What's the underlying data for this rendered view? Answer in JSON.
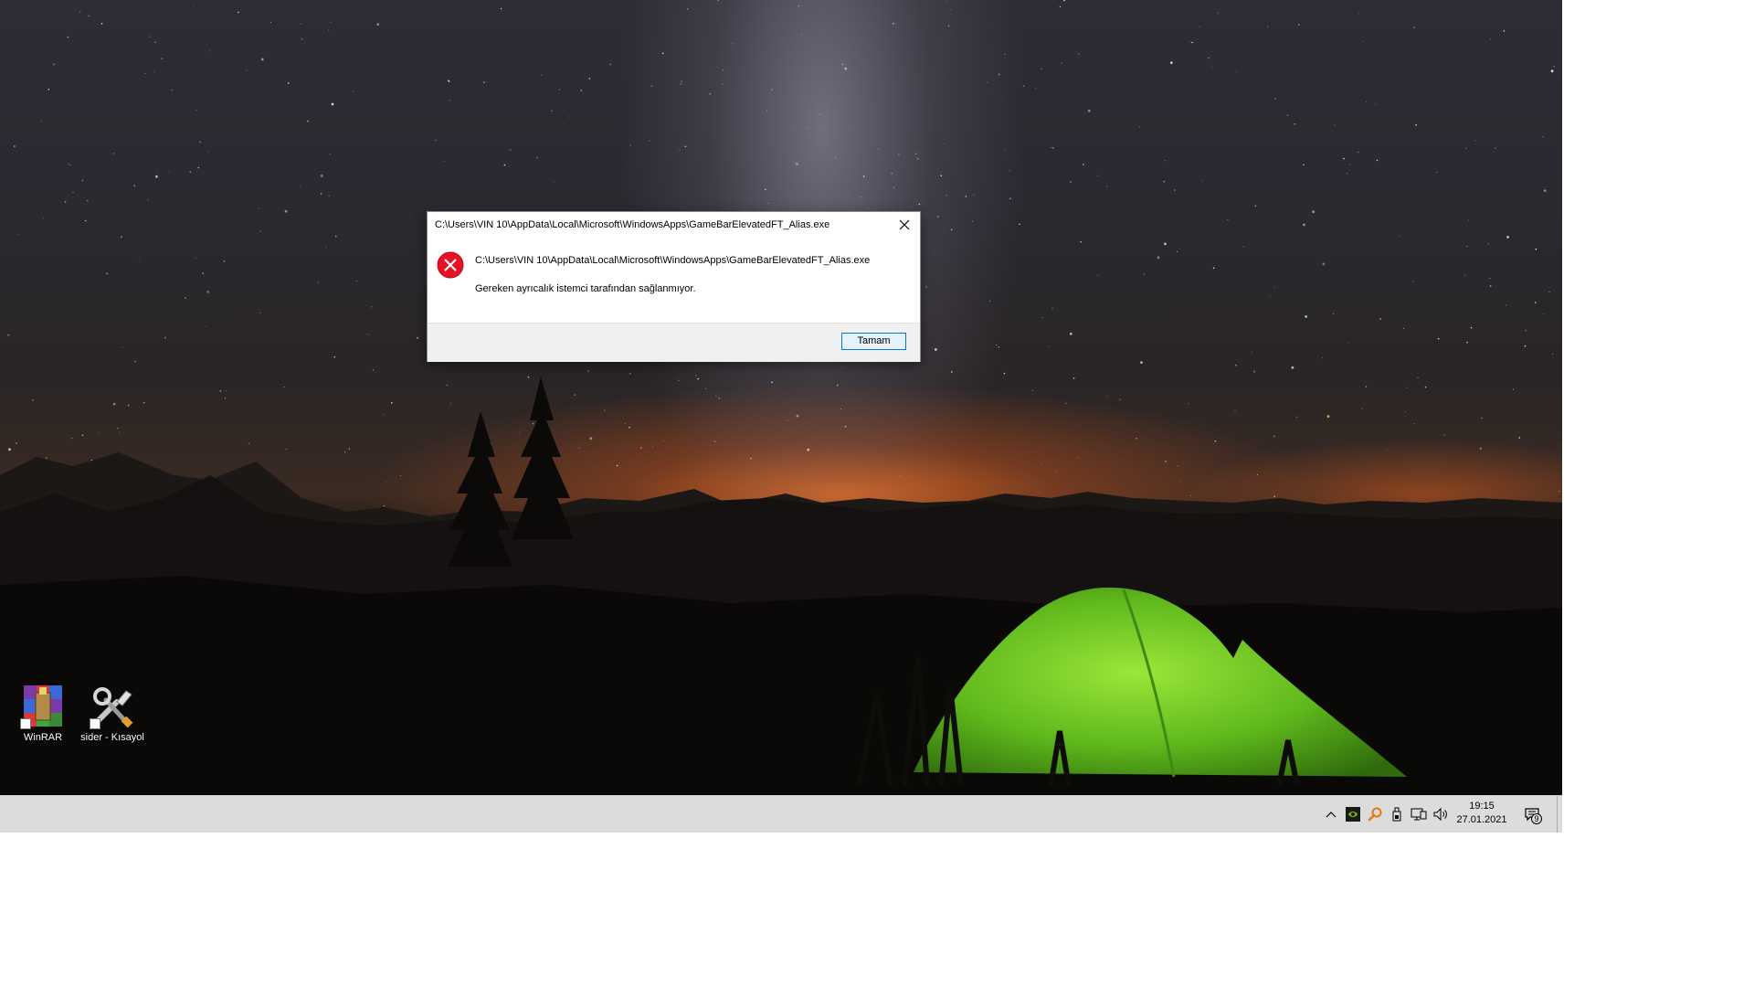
{
  "dialog": {
    "title": "C:\\Users\\VIN 10\\AppData\\Local\\Microsoft\\WindowsApps\\GameBarElevatedFT_Alias.exe",
    "message_path": "C:\\Users\\VIN 10\\AppData\\Local\\Microsoft\\WindowsApps\\GameBarElevatedFT_Alias.exe",
    "message_text": "Gereken ayrıcalık istemci tarafından sağlanmıyor.",
    "ok_label": "Tamam",
    "close_icon": "close-icon",
    "status_icon": "error-icon",
    "error_color": "#e81123",
    "accent_color": "#0078d7"
  },
  "desktop": {
    "icons": [
      {
        "label": "WinRAR",
        "icon": "winrar-icon"
      },
      {
        "label": "sider - Kısayol",
        "icon": "tools-icon"
      }
    ]
  },
  "taskbar": {
    "tray_icons": [
      "chevron-up-icon",
      "nvidia-icon",
      "search-key-icon",
      "usb-icon",
      "network-icon",
      "volume-icon"
    ],
    "clock_time": "19:15",
    "clock_date": "27.01.2021",
    "notification_count": "9"
  }
}
